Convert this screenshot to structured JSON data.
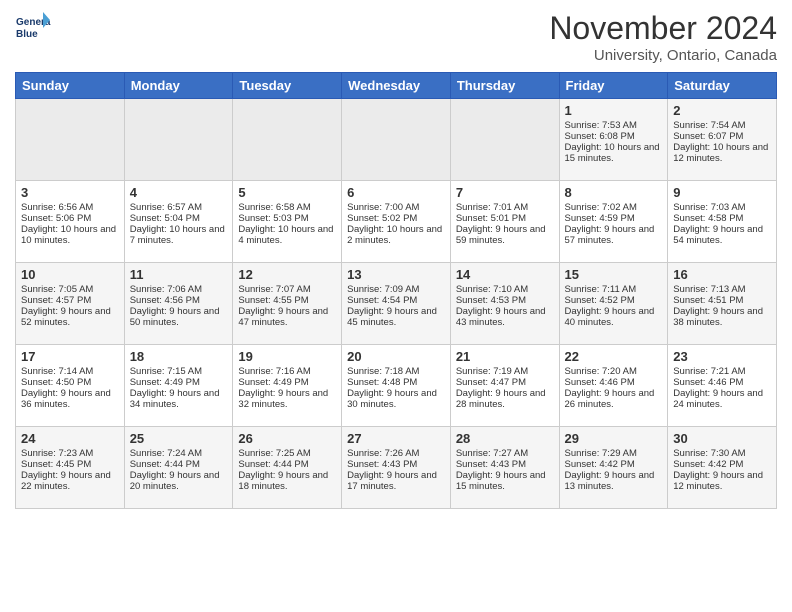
{
  "header": {
    "logo_line1": "General",
    "logo_line2": "Blue",
    "month": "November 2024",
    "location": "University, Ontario, Canada"
  },
  "days_of_week": [
    "Sunday",
    "Monday",
    "Tuesday",
    "Wednesday",
    "Thursday",
    "Friday",
    "Saturday"
  ],
  "weeks": [
    [
      {
        "day": "",
        "empty": true
      },
      {
        "day": "",
        "empty": true
      },
      {
        "day": "",
        "empty": true
      },
      {
        "day": "",
        "empty": true
      },
      {
        "day": "",
        "empty": true
      },
      {
        "day": "1",
        "sunrise": "Sunrise: 7:53 AM",
        "sunset": "Sunset: 6:08 PM",
        "daylight": "Daylight: 10 hours and 15 minutes."
      },
      {
        "day": "2",
        "sunrise": "Sunrise: 7:54 AM",
        "sunset": "Sunset: 6:07 PM",
        "daylight": "Daylight: 10 hours and 12 minutes."
      }
    ],
    [
      {
        "day": "3",
        "sunrise": "Sunrise: 6:56 AM",
        "sunset": "Sunset: 5:06 PM",
        "daylight": "Daylight: 10 hours and 10 minutes."
      },
      {
        "day": "4",
        "sunrise": "Sunrise: 6:57 AM",
        "sunset": "Sunset: 5:04 PM",
        "daylight": "Daylight: 10 hours and 7 minutes."
      },
      {
        "day": "5",
        "sunrise": "Sunrise: 6:58 AM",
        "sunset": "Sunset: 5:03 PM",
        "daylight": "Daylight: 10 hours and 4 minutes."
      },
      {
        "day": "6",
        "sunrise": "Sunrise: 7:00 AM",
        "sunset": "Sunset: 5:02 PM",
        "daylight": "Daylight: 10 hours and 2 minutes."
      },
      {
        "day": "7",
        "sunrise": "Sunrise: 7:01 AM",
        "sunset": "Sunset: 5:01 PM",
        "daylight": "Daylight: 9 hours and 59 minutes."
      },
      {
        "day": "8",
        "sunrise": "Sunrise: 7:02 AM",
        "sunset": "Sunset: 4:59 PM",
        "daylight": "Daylight: 9 hours and 57 minutes."
      },
      {
        "day": "9",
        "sunrise": "Sunrise: 7:03 AM",
        "sunset": "Sunset: 4:58 PM",
        "daylight": "Daylight: 9 hours and 54 minutes."
      }
    ],
    [
      {
        "day": "10",
        "sunrise": "Sunrise: 7:05 AM",
        "sunset": "Sunset: 4:57 PM",
        "daylight": "Daylight: 9 hours and 52 minutes."
      },
      {
        "day": "11",
        "sunrise": "Sunrise: 7:06 AM",
        "sunset": "Sunset: 4:56 PM",
        "daylight": "Daylight: 9 hours and 50 minutes."
      },
      {
        "day": "12",
        "sunrise": "Sunrise: 7:07 AM",
        "sunset": "Sunset: 4:55 PM",
        "daylight": "Daylight: 9 hours and 47 minutes."
      },
      {
        "day": "13",
        "sunrise": "Sunrise: 7:09 AM",
        "sunset": "Sunset: 4:54 PM",
        "daylight": "Daylight: 9 hours and 45 minutes."
      },
      {
        "day": "14",
        "sunrise": "Sunrise: 7:10 AM",
        "sunset": "Sunset: 4:53 PM",
        "daylight": "Daylight: 9 hours and 43 minutes."
      },
      {
        "day": "15",
        "sunrise": "Sunrise: 7:11 AM",
        "sunset": "Sunset: 4:52 PM",
        "daylight": "Daylight: 9 hours and 40 minutes."
      },
      {
        "day": "16",
        "sunrise": "Sunrise: 7:13 AM",
        "sunset": "Sunset: 4:51 PM",
        "daylight": "Daylight: 9 hours and 38 minutes."
      }
    ],
    [
      {
        "day": "17",
        "sunrise": "Sunrise: 7:14 AM",
        "sunset": "Sunset: 4:50 PM",
        "daylight": "Daylight: 9 hours and 36 minutes."
      },
      {
        "day": "18",
        "sunrise": "Sunrise: 7:15 AM",
        "sunset": "Sunset: 4:49 PM",
        "daylight": "Daylight: 9 hours and 34 minutes."
      },
      {
        "day": "19",
        "sunrise": "Sunrise: 7:16 AM",
        "sunset": "Sunset: 4:49 PM",
        "daylight": "Daylight: 9 hours and 32 minutes."
      },
      {
        "day": "20",
        "sunrise": "Sunrise: 7:18 AM",
        "sunset": "Sunset: 4:48 PM",
        "daylight": "Daylight: 9 hours and 30 minutes."
      },
      {
        "day": "21",
        "sunrise": "Sunrise: 7:19 AM",
        "sunset": "Sunset: 4:47 PM",
        "daylight": "Daylight: 9 hours and 28 minutes."
      },
      {
        "day": "22",
        "sunrise": "Sunrise: 7:20 AM",
        "sunset": "Sunset: 4:46 PM",
        "daylight": "Daylight: 9 hours and 26 minutes."
      },
      {
        "day": "23",
        "sunrise": "Sunrise: 7:21 AM",
        "sunset": "Sunset: 4:46 PM",
        "daylight": "Daylight: 9 hours and 24 minutes."
      }
    ],
    [
      {
        "day": "24",
        "sunrise": "Sunrise: 7:23 AM",
        "sunset": "Sunset: 4:45 PM",
        "daylight": "Daylight: 9 hours and 22 minutes."
      },
      {
        "day": "25",
        "sunrise": "Sunrise: 7:24 AM",
        "sunset": "Sunset: 4:44 PM",
        "daylight": "Daylight: 9 hours and 20 minutes."
      },
      {
        "day": "26",
        "sunrise": "Sunrise: 7:25 AM",
        "sunset": "Sunset: 4:44 PM",
        "daylight": "Daylight: 9 hours and 18 minutes."
      },
      {
        "day": "27",
        "sunrise": "Sunrise: 7:26 AM",
        "sunset": "Sunset: 4:43 PM",
        "daylight": "Daylight: 9 hours and 17 minutes."
      },
      {
        "day": "28",
        "sunrise": "Sunrise: 7:27 AM",
        "sunset": "Sunset: 4:43 PM",
        "daylight": "Daylight: 9 hours and 15 minutes."
      },
      {
        "day": "29",
        "sunrise": "Sunrise: 7:29 AM",
        "sunset": "Sunset: 4:42 PM",
        "daylight": "Daylight: 9 hours and 13 minutes."
      },
      {
        "day": "30",
        "sunrise": "Sunrise: 7:30 AM",
        "sunset": "Sunset: 4:42 PM",
        "daylight": "Daylight: 9 hours and 12 minutes."
      }
    ]
  ]
}
